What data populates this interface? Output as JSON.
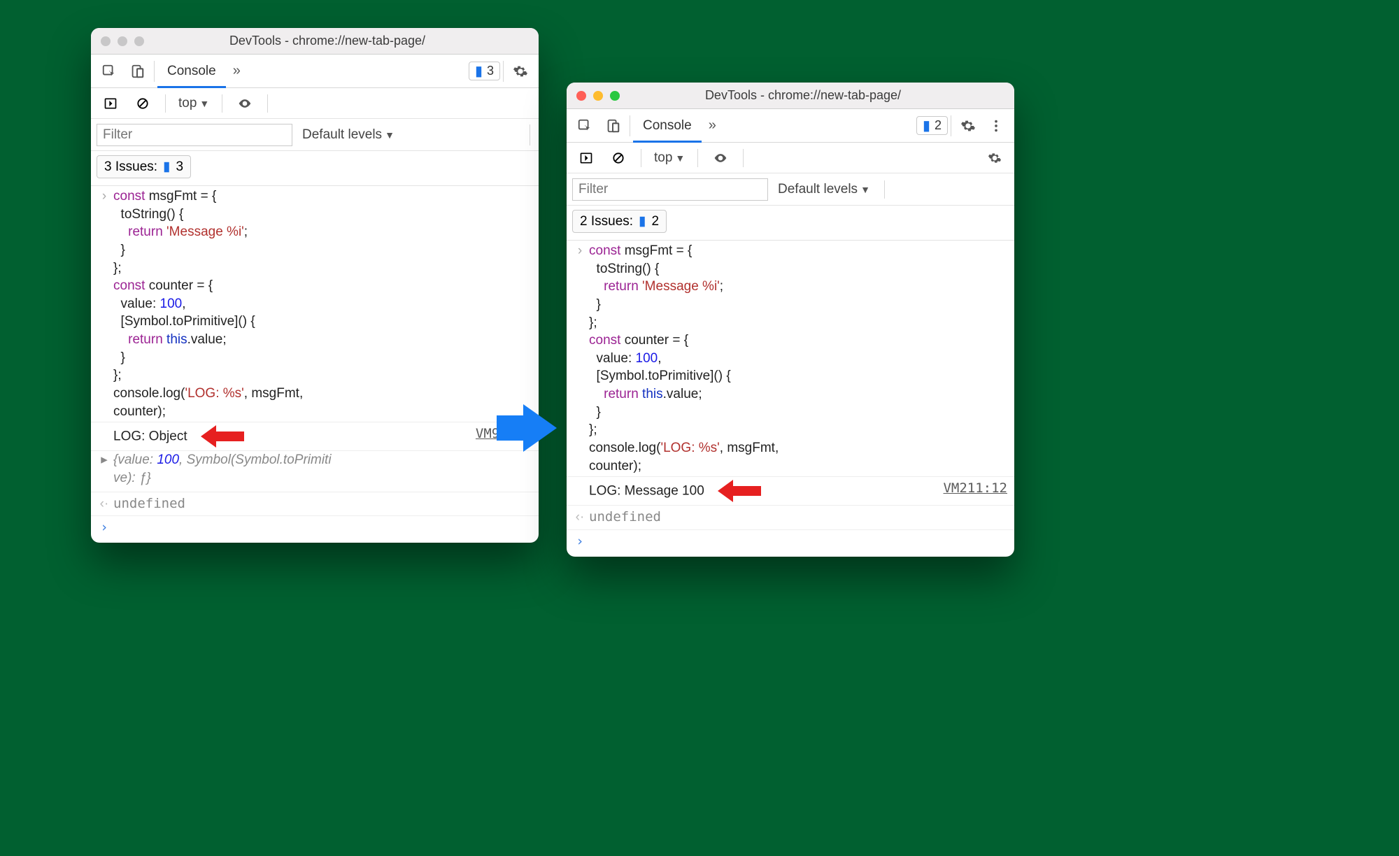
{
  "windowTitle": "DevTools - chrome://new-tab-page/",
  "activeTab": "Console",
  "context": "top",
  "filterPlaceholder": "Filter",
  "levelsLabel": "Default levels",
  "left": {
    "badgeCount": "3",
    "issuesLabel": "3 Issues:",
    "issuesCount": "3",
    "logOutput": "LOG: Object",
    "sourceLink": "VM93:12",
    "objectPreview": "{value: 100, Symbol(Symbol.toPrimitive): ƒ}",
    "returnVal": "undefined"
  },
  "right": {
    "badgeCount": "2",
    "issuesLabel": "2 Issues:",
    "issuesCount": "2",
    "logOutput": "LOG: Message 100",
    "sourceLink": "VM211:12",
    "returnVal": "undefined"
  },
  "code": {
    "l1a": "const",
    "l1b": " msgFmt = {",
    "l2": "  toString() {",
    "l3a": "    ",
    "l3b": "return",
    "l3c": " ",
    "l3d": "'Message %i'",
    "l3e": ";",
    "l4": "  }",
    "l5": "};",
    "l6a": "const",
    "l6b": " counter = {",
    "l7a": "  value: ",
    "l7b": "100",
    "l7c": ",",
    "l8": "  [Symbol.toPrimitive]() {",
    "l9a": "    ",
    "l9b": "return",
    "l9c": " ",
    "l9d": "this",
    "l9e": ".value;",
    "l10": "  }",
    "l11": "};",
    "l12a": "console.log(",
    "l12b": "'LOG: %s'",
    "l12c": ", msgFmt,",
    "l13": "counter);"
  },
  "obj": {
    "valKey": "value: ",
    "valNum": "100"
  }
}
